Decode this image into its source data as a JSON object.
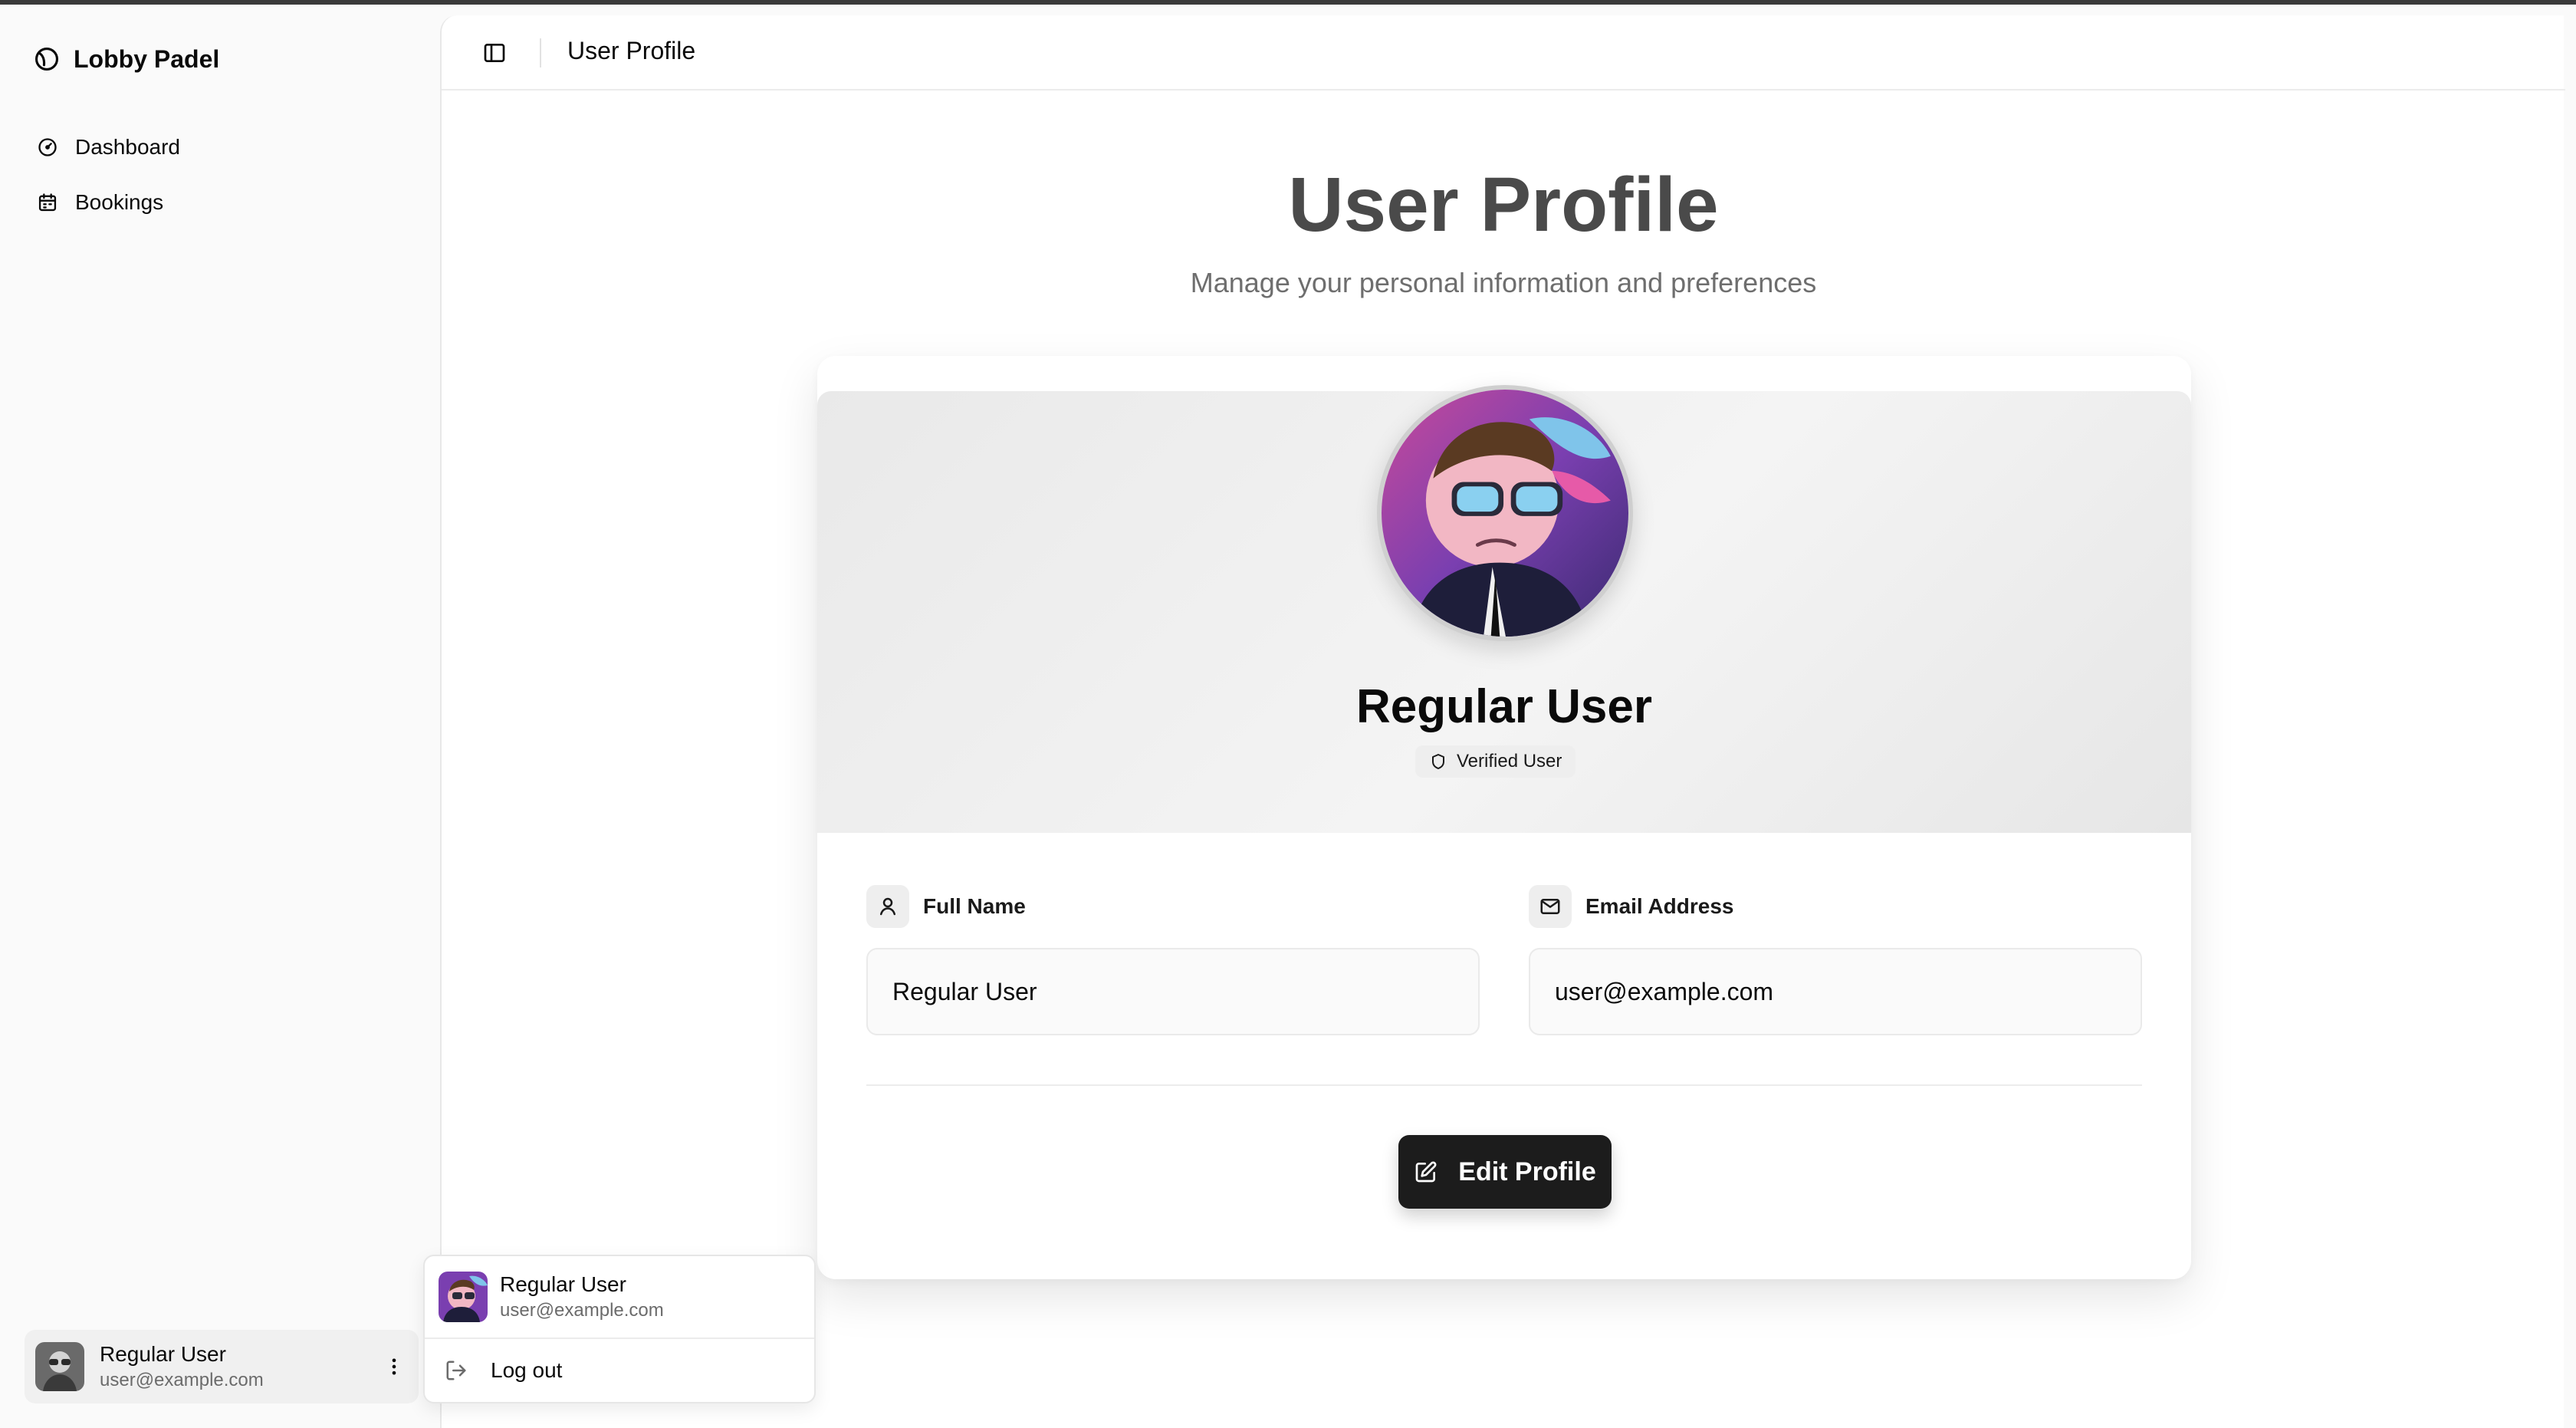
{
  "app": {
    "name": "Lobby Padel"
  },
  "sidebar": {
    "items": [
      {
        "label": "Dashboard",
        "icon": "gauge-icon"
      },
      {
        "label": "Bookings",
        "icon": "calendar-icon"
      }
    ],
    "user": {
      "name": "Regular User",
      "email": "user@example.com"
    }
  },
  "header": {
    "title": "User Profile"
  },
  "page": {
    "title": "User Profile",
    "subtitle": "Manage your personal information and preferences"
  },
  "profile": {
    "name": "Regular User",
    "badge": "Verified User",
    "fields": {
      "full_name": {
        "label": "Full Name",
        "value": "Regular User"
      },
      "email": {
        "label": "Email Address",
        "value": "user@example.com"
      }
    },
    "edit_label": "Edit Profile"
  },
  "menu": {
    "user": {
      "name": "Regular User",
      "email": "user@example.com"
    },
    "logout_label": "Log out"
  },
  "colors": {
    "primary_button": "#1c1c1c",
    "title_text": "#4a4a4a",
    "muted_text": "#6e6e6e"
  }
}
